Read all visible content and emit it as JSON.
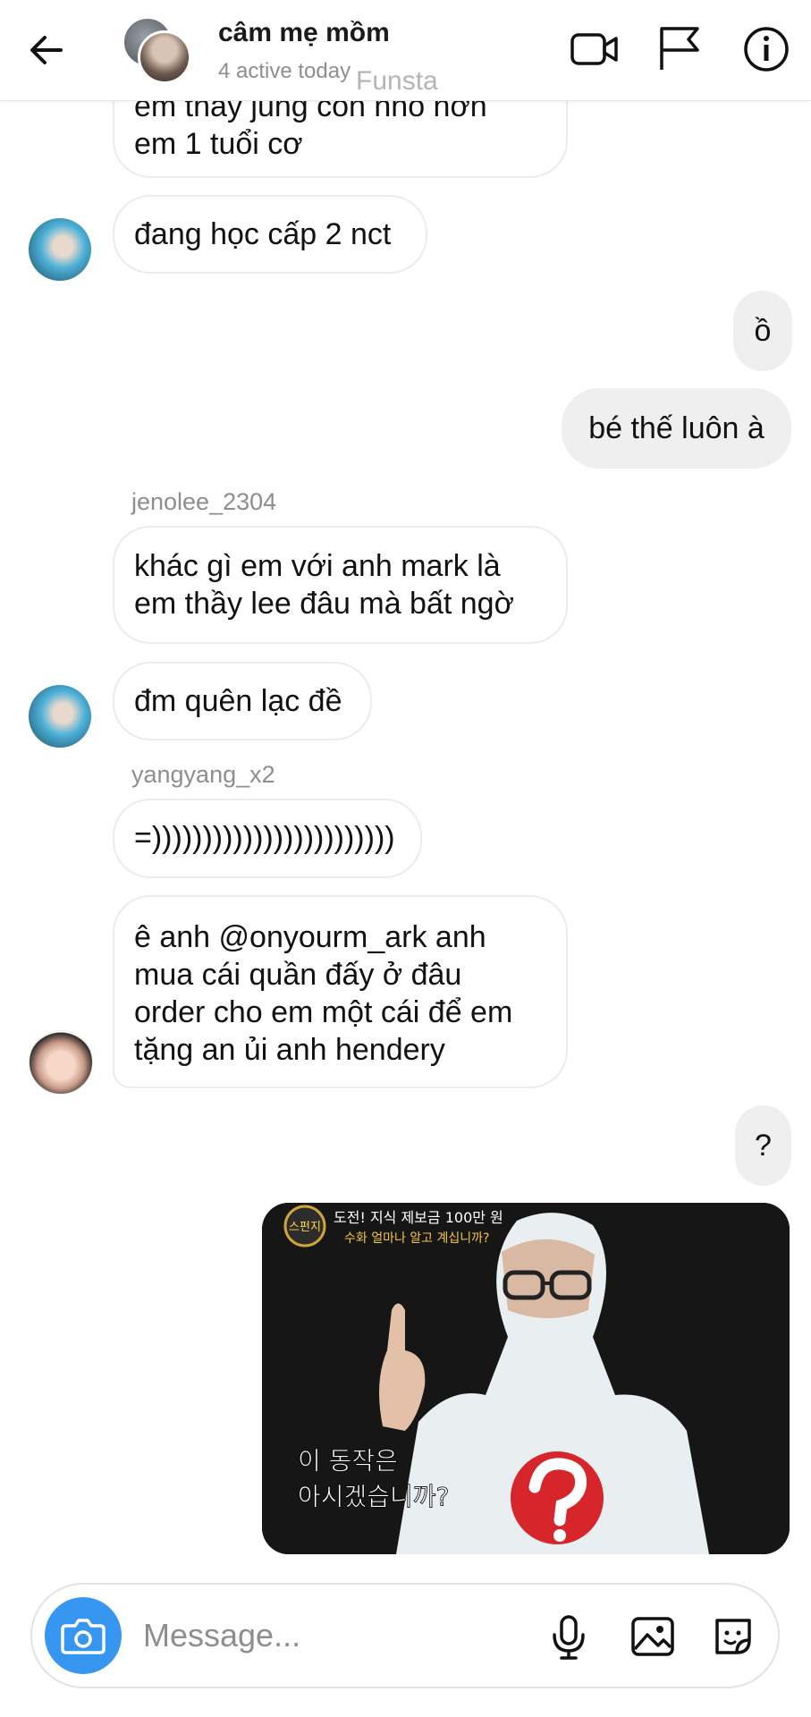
{
  "header": {
    "title": "câm mẹ mồm",
    "status": "4 active today",
    "watermark": "Funsta"
  },
  "messages": {
    "m1": {
      "line1": "em thầy jung còn nhỏ hơn",
      "line2": "em 1 tuổi cơ"
    },
    "m2": "đang học cấp 2 nct",
    "m3": "ồ",
    "m4": "bé thế luôn à",
    "sender1": "jenolee_2304",
    "m5": {
      "line1": "khác gì em với anh mark là",
      "line2": "em thầy lee đâu mà bất ngờ"
    },
    "m6": "đm quên lạc đề",
    "sender2": "yangyang_x2",
    "m7": "=))))))))))))))))))))))))",
    "m8": {
      "line1": "ê anh @onyourm_ark anh",
      "line2": "mua cái quần đấy ở đâu",
      "line3": "order cho em một cái để em",
      "line4": "tặng an ủi anh hendery"
    },
    "m9": "?"
  },
  "photo": {
    "caption_top1": "도전! 지식 제보금 100만 원",
    "caption_top2": "수화 얼마나 알고 계십니까?",
    "caption_bottom1": "이 동작은",
    "caption_bottom2": "아시겠습니까?",
    "badge": "스펀지"
  },
  "composer": {
    "placeholder": "Message..."
  },
  "colors": {
    "accent": "#3797f0",
    "outgoing_bubble": "#efefef",
    "incoming_border": "#ececec",
    "muted_text": "#8e8e8e"
  },
  "icons": [
    "back-arrow-icon",
    "video-call-icon",
    "flag-icon",
    "info-icon",
    "camera-icon",
    "microphone-icon",
    "gallery-icon",
    "sticker-icon"
  ]
}
